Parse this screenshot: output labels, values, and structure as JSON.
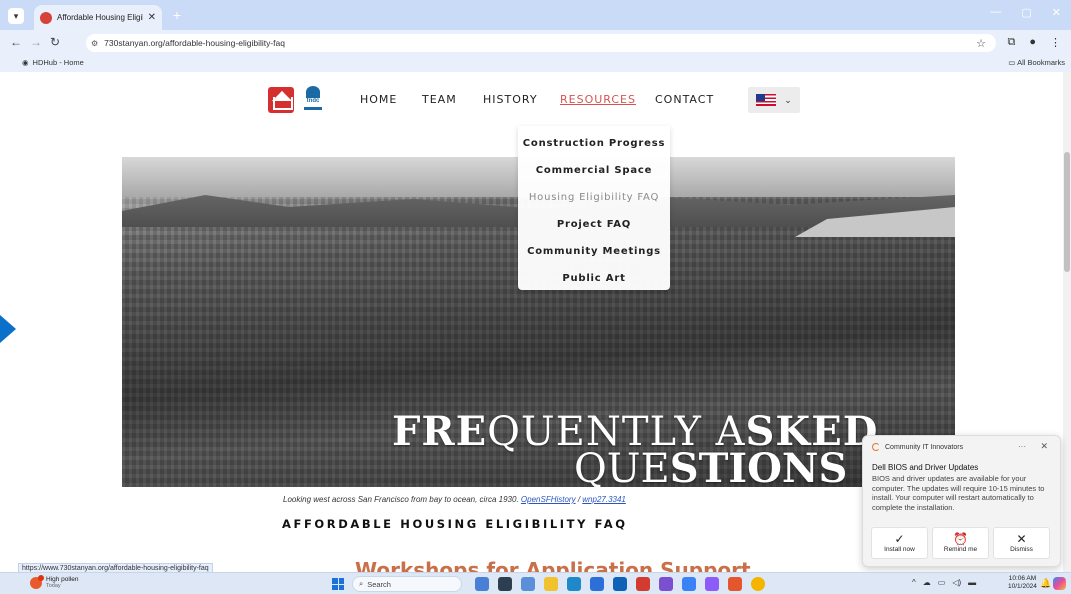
{
  "browser": {
    "tab_title": "Affordable Housing Eligibility FAQ",
    "tab_close": "✕",
    "new_tab": "+",
    "url": "730stanyan.org/affordable-housing-eligibility-faq",
    "bookmark_item": "HDHub - Home",
    "all_bookmarks": "All Bookmarks",
    "status_url": "https://www.730stanyan.org/affordable-housing-eligibility-faq"
  },
  "nav": {
    "home": "HOME",
    "team": "TEAM",
    "history": "HISTORY",
    "resources": "RESOURCES",
    "contact": "CONTACT"
  },
  "dropdown": [
    "Construction Progress",
    "Commercial Space",
    "Housing Eligibility FAQ",
    "Project FAQ",
    "Community Meetings",
    "Public Art"
  ],
  "hero": {
    "line1_bold": "FRE",
    "line1_light": "QUENTLY A",
    "line1_bold2": "SKED",
    "line2_light": "QUE",
    "line2_bold": "STIONS"
  },
  "caption": {
    "text": "Looking west across San Francisco from bay to ocean, circa 1930.",
    "link1": "OpenSFHistory",
    "sep": " / ",
    "link2": "wnp27.3341"
  },
  "page": {
    "heading": "AFFORDABLE HOUSING ELIGIBILITY FAQ",
    "subheading": "Workshops for Application Support"
  },
  "logo": {
    "tndc": "tndc"
  },
  "toast": {
    "source": "Community IT Innovators",
    "title": "Dell BIOS and Driver Updates",
    "body": "BIOS and driver updates are available for your computer. The updates will require 10-15 minutes to install. Your computer will restart automatically to complete the installation.",
    "btn_install": "Install now",
    "btn_remind": "Remind me",
    "btn_dismiss": "Dismiss"
  },
  "taskbar": {
    "weather_title": "High pollen",
    "weather_sub": "Today",
    "search": "Search",
    "time": "10:06 AM",
    "date": "10/1/2024"
  },
  "colors": {
    "accent": "#d9534f",
    "heading_orange": "#c8704a",
    "link": "#2a55c4",
    "chrome": "#c9dbf6"
  }
}
